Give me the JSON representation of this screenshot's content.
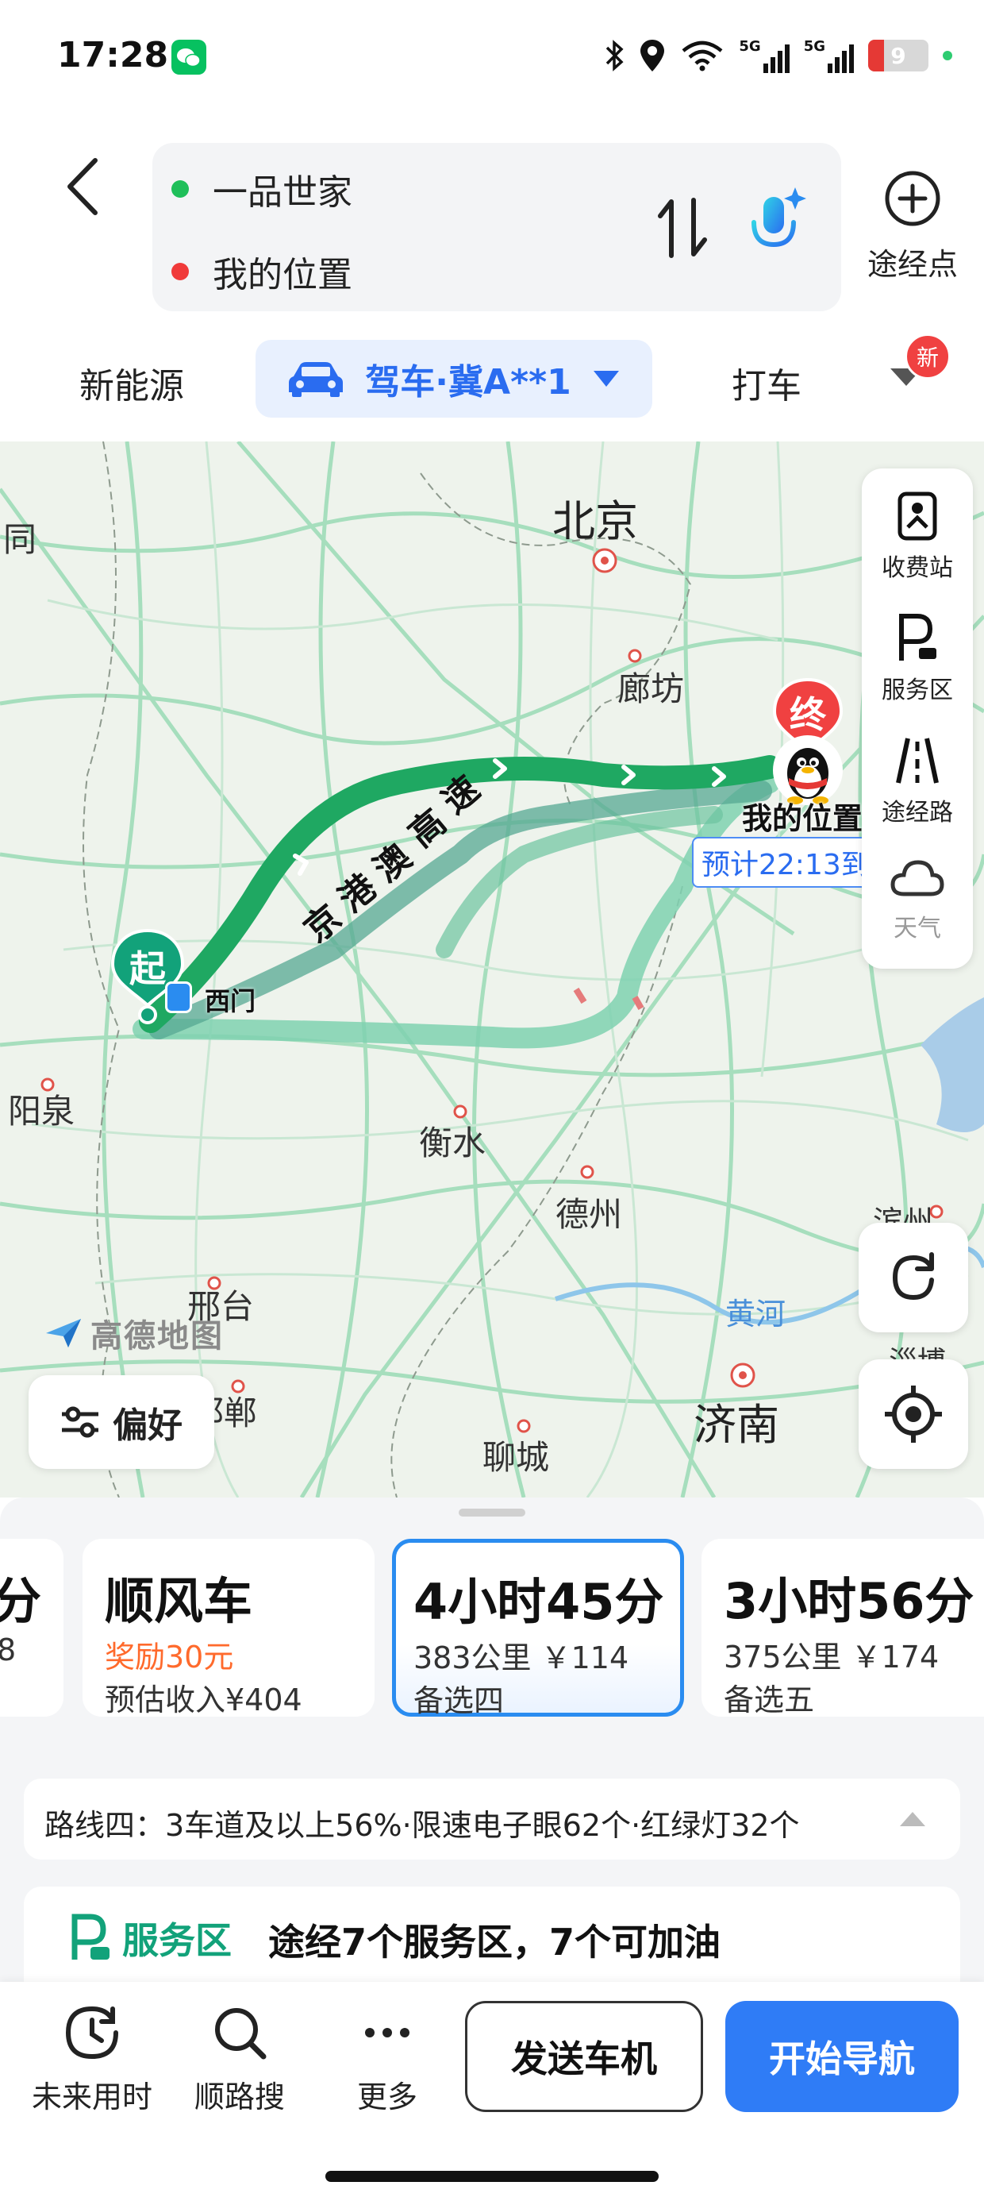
{
  "status_bar": {
    "time": "17:28",
    "network_1": "5G",
    "network_2": "5G",
    "battery": "9",
    "icons": [
      "wechat-icon",
      "bluetooth-icon",
      "location-icon",
      "wifi-icon",
      "signal-icon",
      "battery-icon"
    ]
  },
  "header": {
    "from": "一品世家",
    "to": "我的位置",
    "waypoint_label": "途经点",
    "from_dot_color": "#1fbf5a",
    "to_dot_color": "#f03a3a"
  },
  "mode_tabs": {
    "nev": "新能源",
    "drive": "驾车·冀A**1",
    "taxi": "打车",
    "new_badge": "新"
  },
  "map": {
    "cities": {
      "datong": "同",
      "beijing": "北京",
      "langfang": "廊坊",
      "yangquan": "阳泉",
      "hengshui": "衡水",
      "dezhou": "德州",
      "xingtai": "邢台",
      "handan": "邯郸",
      "liaocheng": "聊城",
      "jinan": "济南",
      "yellow_river": "黄河",
      "binzhou": "滨州",
      "zibo": "淄博"
    },
    "highway_chars": [
      "京",
      "港",
      "澳",
      "高",
      "速"
    ],
    "start_pin": "起",
    "end_pin": "终",
    "start_place": "西门",
    "end_place": "我的位置",
    "eta": "预计22:13到",
    "logo": "高德地图",
    "side_panel": {
      "toll": "收费站",
      "service": "服务区",
      "via_road": "途经路",
      "weather": "天气"
    },
    "preference": "偏好",
    "route_color": "#1fa862",
    "alt_route_color": "#6cc3a0"
  },
  "routes": {
    "cards": [
      {
        "title": "分",
        "sub1": "8",
        "sub2": ""
      },
      {
        "title": "顺风车",
        "sub1": "奖励30元",
        "sub2": "预估收入¥404"
      },
      {
        "title": "4小时45分",
        "sub1": "383公里 ￥114",
        "sub2": "备选四"
      },
      {
        "title": "3小时56分",
        "sub1": "375公里 ￥174",
        "sub2": "备选五"
      }
    ],
    "info": "路线四：3车道及以上56%·限速电子眼62个·红绿灯32个",
    "service_label": "服务区",
    "service_desc": "途经7个服务区，7个可加油"
  },
  "bottom_bar": {
    "future": "未来用时",
    "search": "顺路搜",
    "more": "更多",
    "send": "发送车机",
    "navigate": "开始导航"
  }
}
